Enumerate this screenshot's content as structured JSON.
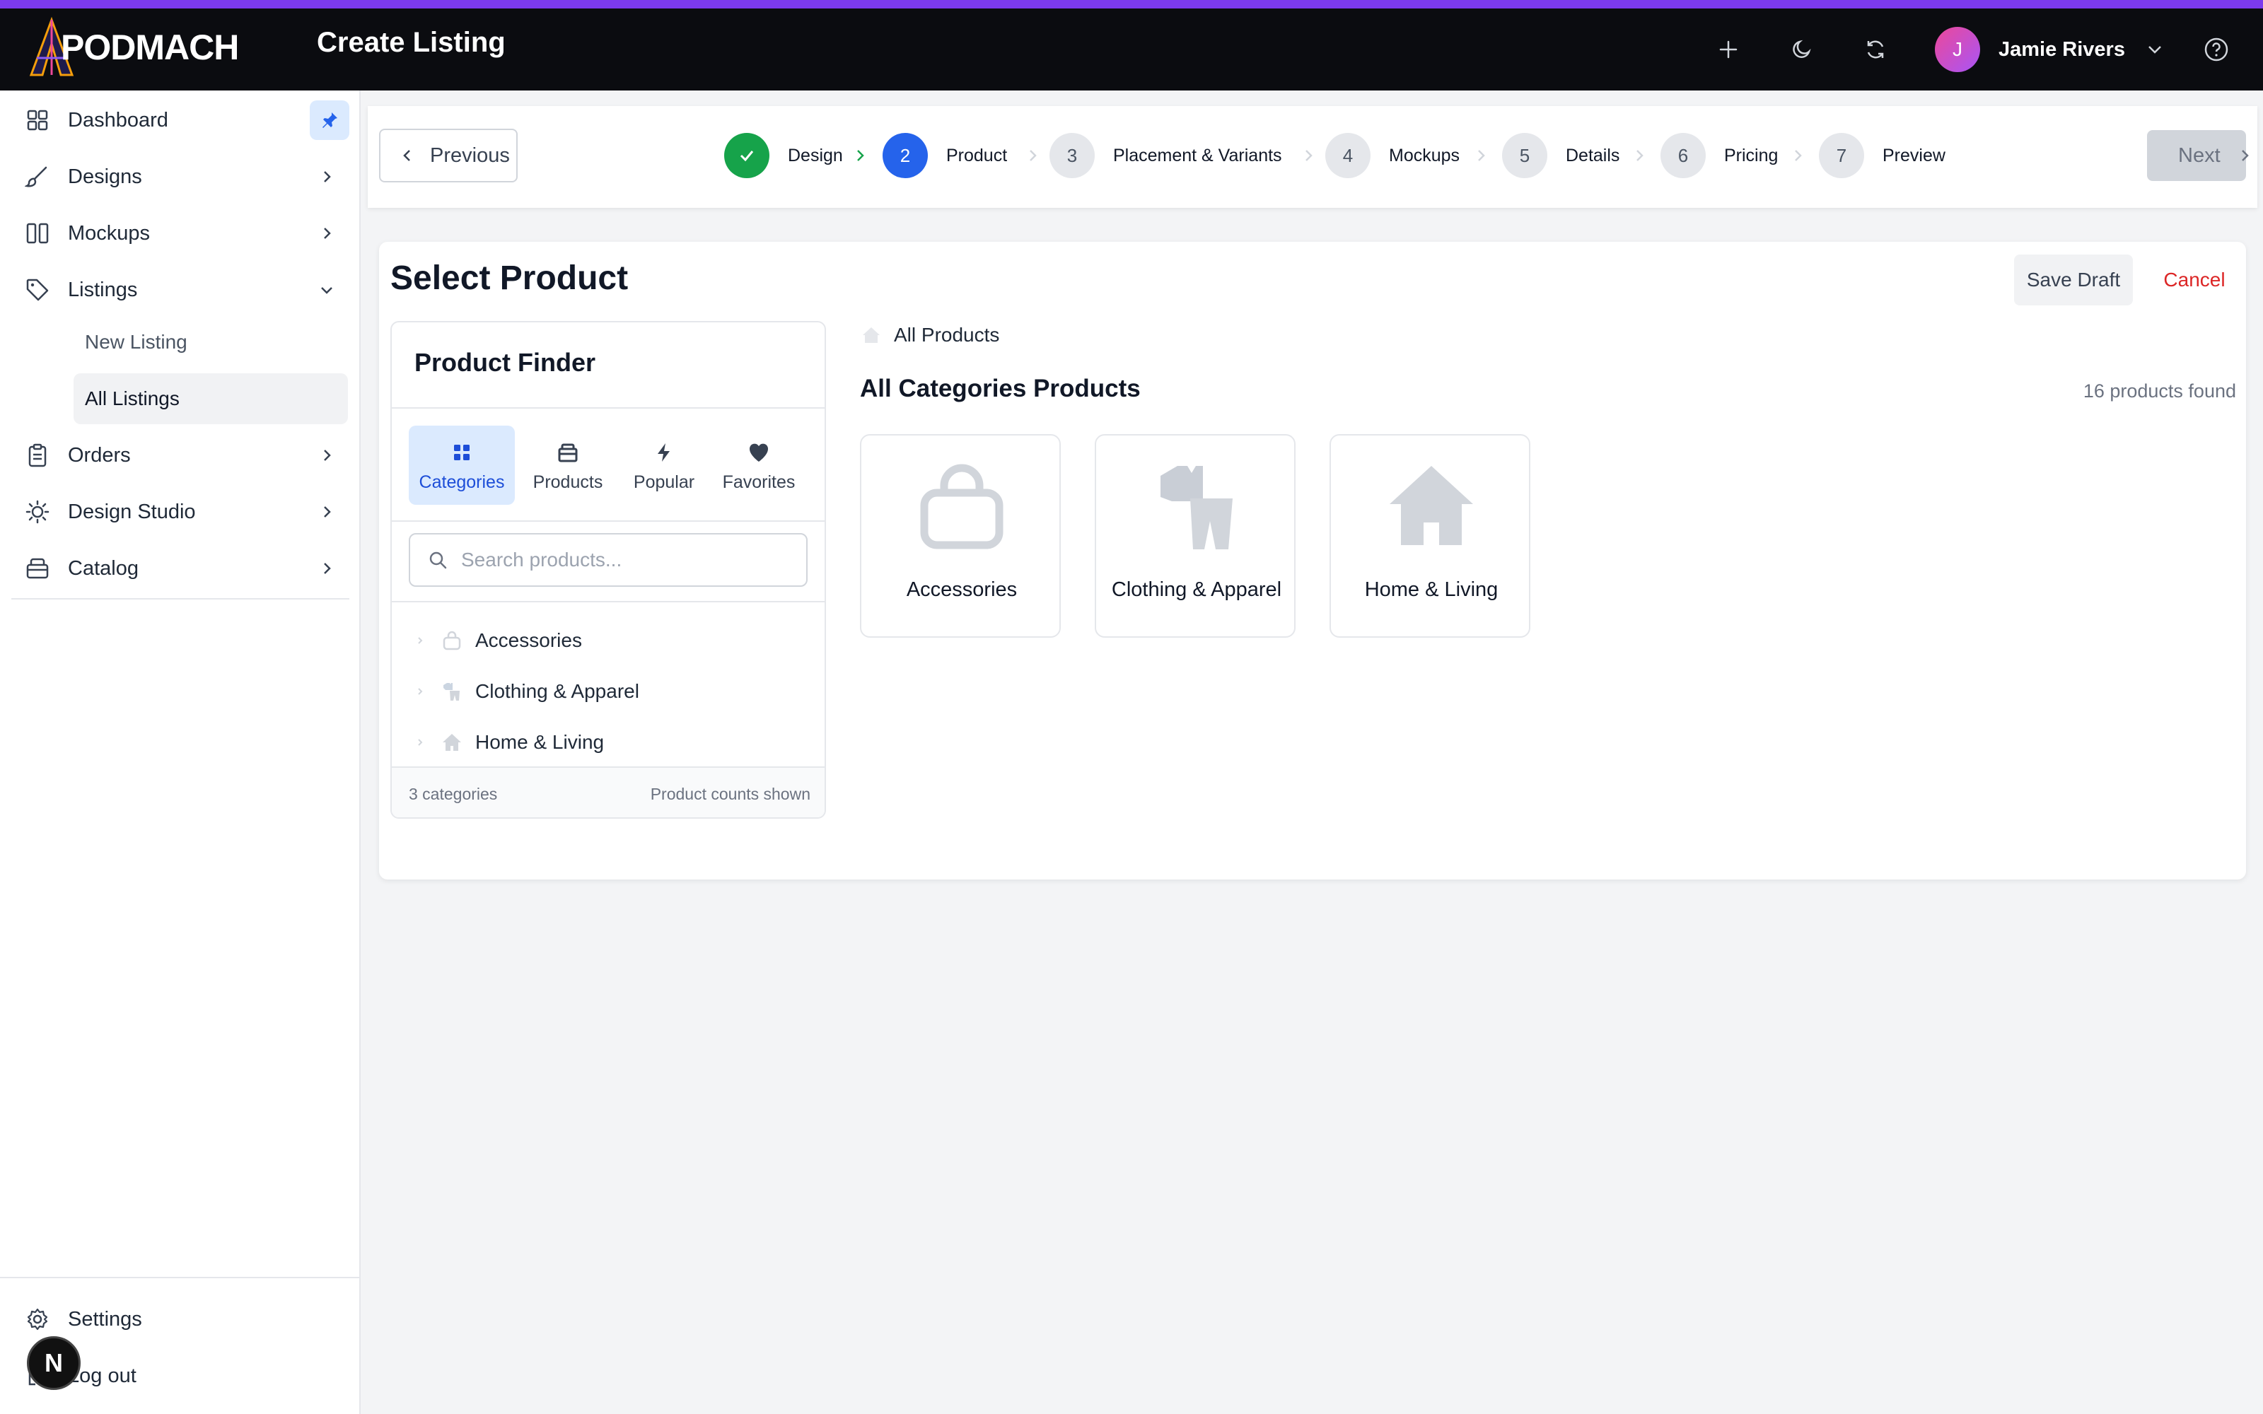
{
  "app": {
    "brand": "PODMACH",
    "page_title": "Create Listing",
    "user_name": "Jamie Rivers",
    "user_initial": "J",
    "accent_color": "#7c3aed"
  },
  "sidebar": {
    "items": [
      {
        "label": "Dashboard",
        "icon": "dashboard-icon"
      },
      {
        "label": "Designs",
        "icon": "brush-icon"
      },
      {
        "label": "Mockups",
        "icon": "columns-icon"
      },
      {
        "label": "Listings",
        "icon": "tag-icon"
      },
      {
        "label": "Orders",
        "icon": "clipboard-icon"
      },
      {
        "label": "Design Studio",
        "icon": "lightbulb-icon"
      },
      {
        "label": "Catalog",
        "icon": "box-icon"
      }
    ],
    "listings_sub": [
      {
        "label": "New Listing"
      },
      {
        "label": "All Listings",
        "active": true
      }
    ],
    "bottom": [
      {
        "label": "Settings",
        "icon": "gear-icon"
      },
      {
        "label": "Log out",
        "icon": "logout-icon"
      }
    ],
    "badge_letter": "N"
  },
  "stepper": {
    "previous_label": "Previous",
    "next_label": "Next",
    "steps": [
      {
        "number": "✓",
        "label": "Design",
        "state": "done"
      },
      {
        "number": "2",
        "label": "Product",
        "state": "current"
      },
      {
        "number": "3",
        "label": "Placement & Variants",
        "state": "todo"
      },
      {
        "number": "4",
        "label": "Mockups",
        "state": "todo"
      },
      {
        "number": "5",
        "label": "Details",
        "state": "todo"
      },
      {
        "number": "6",
        "label": "Pricing",
        "state": "todo"
      },
      {
        "number": "7",
        "label": "Preview",
        "state": "todo"
      }
    ]
  },
  "main": {
    "title": "Select Product",
    "save_draft_label": "Save Draft",
    "cancel_label": "Cancel"
  },
  "finder": {
    "title": "Product Finder",
    "tabs": [
      {
        "label": "Categories",
        "icon": "grid-icon",
        "active": true
      },
      {
        "label": "Products",
        "icon": "box-icon"
      },
      {
        "label": "Popular",
        "icon": "bolt-icon"
      },
      {
        "label": "Favorites",
        "icon": "heart-icon"
      }
    ],
    "search_placeholder": "Search products...",
    "search_value": "",
    "tree": [
      {
        "label": "Accessories",
        "icon": "bag-icon"
      },
      {
        "label": "Clothing & Apparel",
        "icon": "shirt-icon"
      },
      {
        "label": "Home & Living",
        "icon": "home-icon"
      }
    ],
    "footer_left": "3 categories",
    "footer_right": "Product counts shown"
  },
  "grid": {
    "breadcrumb": "All Products",
    "title": "All Categories Products",
    "count_text": "16 products found",
    "cards": [
      {
        "label": "Accessories",
        "icon": "bag-icon"
      },
      {
        "label": "Clothing & Apparel",
        "icon": "shirt-icon"
      },
      {
        "label": "Home & Living",
        "icon": "home-icon"
      }
    ]
  }
}
